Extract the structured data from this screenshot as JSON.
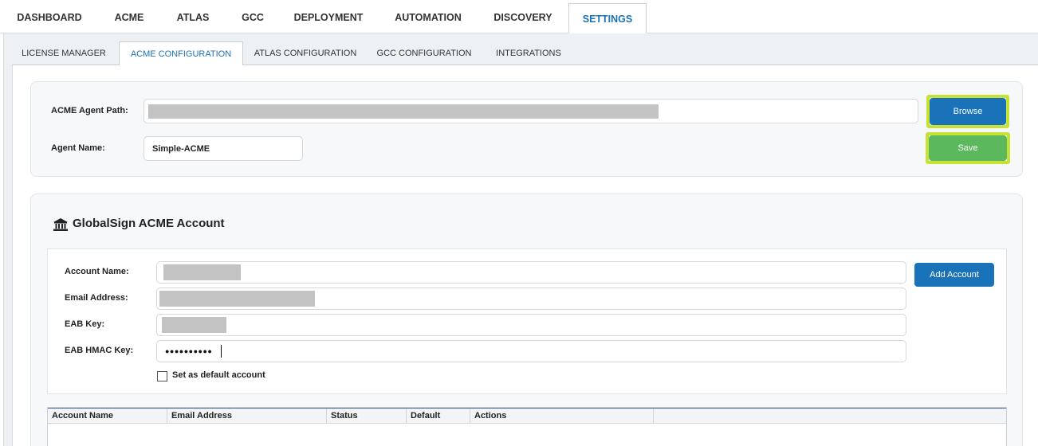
{
  "top_nav": {
    "tabs": [
      "DASHBOARD",
      "ACME",
      "ATLAS",
      "GCC",
      "DEPLOYMENT",
      "AUTOMATION",
      "DISCOVERY",
      "SETTINGS"
    ],
    "active": "SETTINGS"
  },
  "sub_nav": {
    "tabs": [
      "LICENSE MANAGER",
      "ACME CONFIGURATION",
      "ATLAS CONFIGURATION",
      "GCC CONFIGURATION",
      "INTEGRATIONS"
    ],
    "active": "ACME CONFIGURATION"
  },
  "agent_config": {
    "path_label": "ACME Agent Path:",
    "path_value": "",
    "name_label": "Agent Name:",
    "name_value": "Simple-ACME",
    "browse_label": "Browse",
    "save_label": "Save"
  },
  "account_section": {
    "title": "GlobalSign ACME Account",
    "icon": "bank-icon",
    "fields": {
      "account_name_label": "Account Name:",
      "email_label": "Email Address:",
      "eab_key_label": "EAB Key:",
      "eab_hmac_label": "EAB HMAC Key:",
      "eab_hmac_value": "●●●●●●●●●●"
    },
    "add_account_label": "Add Account",
    "default_checkbox_label": "Set as default account",
    "default_checked": false
  },
  "accounts_table": {
    "columns": [
      "Account Name",
      "Email Address",
      "Status",
      "Default",
      "Actions"
    ],
    "rows": []
  },
  "colors": {
    "primary": "#1a72b8",
    "save_green": "#5cb85c",
    "highlight": "#c6e234"
  }
}
